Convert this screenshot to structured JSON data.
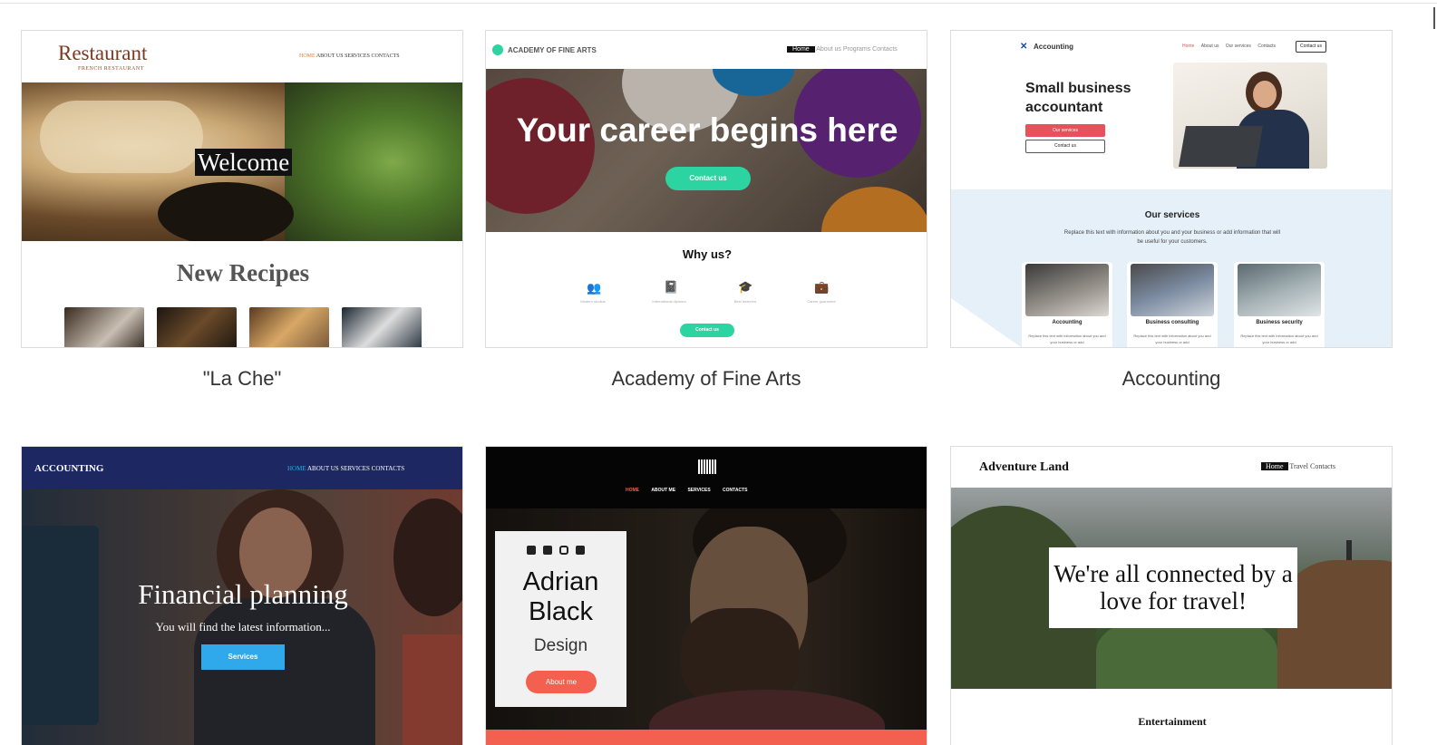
{
  "cards": [
    {
      "caption": "\"La Che\"",
      "brand": "Restaurant",
      "brand_sub": "FRENCH RESTAURANT",
      "nav": [
        "HOME",
        "ABOUT US",
        "SERVICES",
        "CONTACTS"
      ],
      "hero_text": "Welcome",
      "section_title": "New Recipes"
    },
    {
      "caption": "Academy of Fine Arts",
      "brand": "ACADEMY OF FINE ARTS",
      "nav": [
        "Home",
        "About us",
        "Programs",
        "Contacts"
      ],
      "hero_text": "Your career begins here",
      "hero_button": "Contact us",
      "section_title": "Why us?",
      "features": [
        "Modern studios",
        "International diploma",
        "Best lecturers",
        "Career guarantee"
      ],
      "cta": "Contact us"
    },
    {
      "caption": "Accounting",
      "brand": "Accounting",
      "nav": [
        "Home",
        "About us",
        "Our services",
        "Contacts"
      ],
      "nav_button": "Contact us",
      "hero_title": "Small business accountant",
      "btn_primary": "Our services",
      "btn_secondary": "Contact us",
      "services_title": "Our services",
      "services_text": "Replace this text with information about you and your business or add information that will be useful for your customers.",
      "services": [
        {
          "name": "Accounting",
          "text": "Replace this text with information about you and your business or add"
        },
        {
          "name": "Business consulting",
          "text": "Replace this text with information about you and your business or add"
        },
        {
          "name": "Business security",
          "text": "Replace this text with information about you and your business or add"
        }
      ]
    },
    {
      "caption": "",
      "brand": "ACCOUNTING",
      "nav": [
        "HOME",
        "ABOUT US",
        "SERVICES",
        "CONTACTS"
      ],
      "hero_title": "Financial planning",
      "hero_sub": "You will find the latest information...",
      "hero_button": "Services"
    },
    {
      "caption": "",
      "nav": [
        "HOME",
        "ABOUT ME",
        "SERVICES",
        "CONTACTS"
      ],
      "name_line1": "Adrian",
      "name_line2": "Black",
      "role": "Design",
      "button": "About me"
    },
    {
      "caption": "",
      "brand": "Adventure Land",
      "nav": [
        "Home",
        "Travel",
        "Contacts"
      ],
      "hero_text": "We're all connected by a love for travel!",
      "section_title": "Entertainment"
    }
  ],
  "colors": {
    "restaurant_accent": "#8a3b20",
    "academy_green": "#2bd4a0",
    "accounting_red": "#e8505b",
    "accounting_bg": "#e6f0f8",
    "finance_navy": "#1d2761",
    "finance_blue": "#30a8ec",
    "adrian_coral": "#f4604f"
  }
}
